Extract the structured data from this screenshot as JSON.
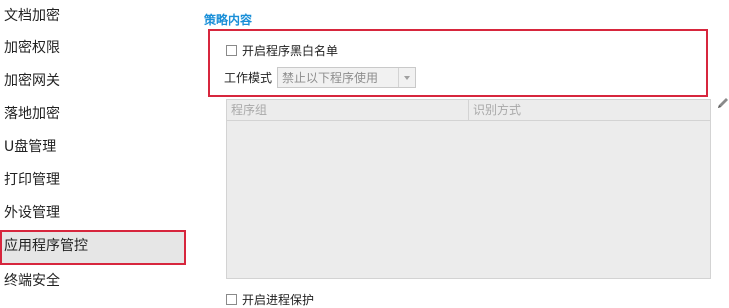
{
  "sidebar": {
    "items": [
      {
        "label": "文档加密"
      },
      {
        "label": "加密权限"
      },
      {
        "label": "加密网关"
      },
      {
        "label": "落地加密"
      },
      {
        "label": "U盘管理"
      },
      {
        "label": "打印管理"
      },
      {
        "label": "外设管理"
      },
      {
        "label": "应用程序管控",
        "active": true
      },
      {
        "label": "终端安全"
      }
    ]
  },
  "main": {
    "section_title": "策略内容",
    "blacklist_checkbox_label": "开启程序黑白名单",
    "blacklist_checked": false,
    "work_mode_label": "工作模式",
    "work_mode_value": "禁止以下程序使用",
    "table": {
      "columns": [
        "程序组",
        "识别方式"
      ],
      "rows": []
    },
    "edit_icon": "pencil-icon",
    "process_protect_label": "开启进程保护",
    "process_protect_checked": false
  },
  "colors": {
    "accent": "#1a8fd8",
    "highlight_border": "#d7263d",
    "active_item_bg": "#e6e6e6"
  }
}
